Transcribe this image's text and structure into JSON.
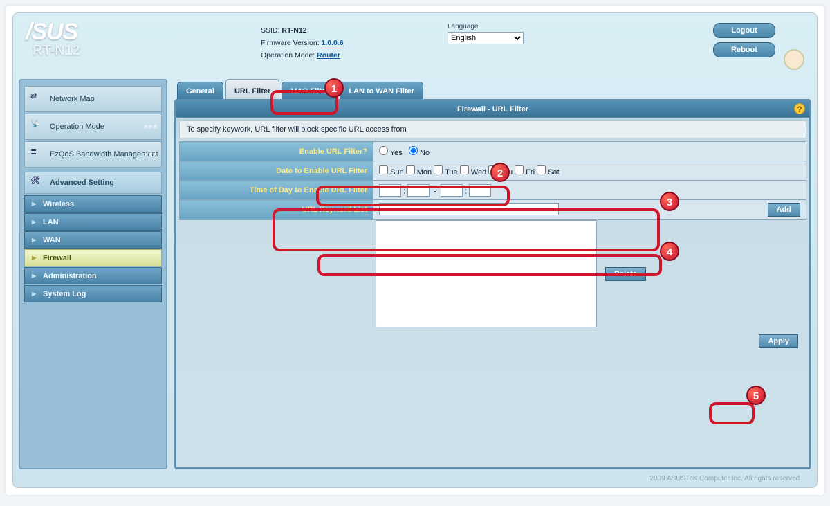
{
  "brand": {
    "logo": "/SUS",
    "model": "RT-N12"
  },
  "sys": {
    "ssid_lbl": "SSID:",
    "ssid": "RT-N12",
    "fw_lbl": "Firmware Version:",
    "fw": "1.0.0.6",
    "op_lbl": "Operation Mode:",
    "op": "Router"
  },
  "lang": {
    "lbl": "Language",
    "selected": "English"
  },
  "header_btn": {
    "logout": "Logout",
    "reboot": "Reboot"
  },
  "sidebar": {
    "items": [
      {
        "label": "Network Map"
      },
      {
        "label": "Operation Mode"
      },
      {
        "label": "EzQoS Bandwidth Management"
      }
    ],
    "adv_title": "Advanced Setting",
    "sub": [
      {
        "label": "Wireless"
      },
      {
        "label": "LAN"
      },
      {
        "label": "WAN"
      },
      {
        "label": "Firewall"
      },
      {
        "label": "Administration"
      },
      {
        "label": "System Log"
      }
    ]
  },
  "tabs": [
    {
      "label": "General"
    },
    {
      "label": "URL Filter"
    },
    {
      "label": "MAC Filter"
    },
    {
      "label": "LAN to WAN Filter"
    }
  ],
  "panel": {
    "title": "Firewall - URL Filter",
    "desc": "To specify keywork, URL filter will block specific URL access from",
    "rows": {
      "enable_lbl": "Enable URL Filter?",
      "yes": "Yes",
      "no": "No",
      "date_lbl": "Date to Enable URL Filter",
      "days": [
        "Sun",
        "Mon",
        "Tue",
        "Wed",
        "Thu",
        "Fri",
        "Sat"
      ],
      "time_lbl": "Time of Day to Enable URL Filter",
      "keyword_lbl": "URL Keyword List"
    },
    "btn": {
      "add": "Add",
      "delete": "Delete",
      "apply": "Apply"
    }
  },
  "footer": "2009 ASUSTeK Computer Inc. All rights reserved."
}
